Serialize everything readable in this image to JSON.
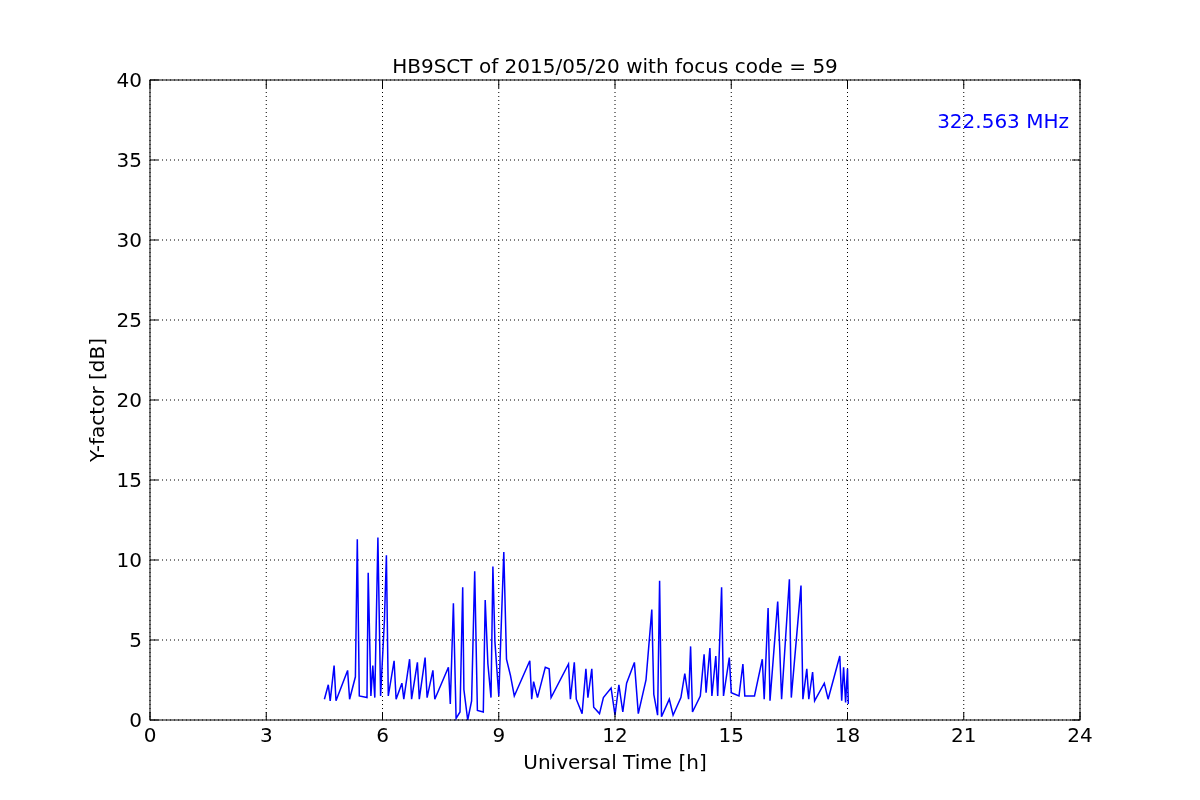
{
  "chart_data": {
    "type": "line",
    "title": "HB9SCT of 2015/05/20 with focus code = 59",
    "xlabel": "Universal Time [h]",
    "ylabel": "Y-factor [dB]",
    "x": [
      4.5,
      4.6,
      4.65,
      4.75,
      4.8,
      5.1,
      5.15,
      5.3,
      5.35,
      5.4,
      5.6,
      5.63,
      5.7,
      5.75,
      5.8,
      5.88,
      5.95,
      6.05,
      6.1,
      6.15,
      6.3,
      6.35,
      6.5,
      6.55,
      6.7,
      6.75,
      6.9,
      6.95,
      7.1,
      7.15,
      7.3,
      7.35,
      7.7,
      7.75,
      7.83,
      7.9,
      8.0,
      8.07,
      8.1,
      8.2,
      8.3,
      8.38,
      8.45,
      8.6,
      8.65,
      8.72,
      8.8,
      8.85,
      8.9,
      9.0,
      9.13,
      9.2,
      9.3,
      9.4,
      9.8,
      9.85,
      9.9,
      10.0,
      10.2,
      10.3,
      10.35,
      10.8,
      10.85,
      10.95,
      11.0,
      11.15,
      11.25,
      11.3,
      11.4,
      11.45,
      11.6,
      11.7,
      11.9,
      12.0,
      12.1,
      12.2,
      12.3,
      12.5,
      12.6,
      12.8,
      12.95,
      13.0,
      13.1,
      13.15,
      13.2,
      13.4,
      13.5,
      13.7,
      13.8,
      13.9,
      13.95,
      14.0,
      14.2,
      14.3,
      14.35,
      14.45,
      14.5,
      14.6,
      14.65,
      14.75,
      14.8,
      14.95,
      15.0,
      15.2,
      15.3,
      15.35,
      15.6,
      15.8,
      15.85,
      15.95,
      16.0,
      16.2,
      16.25,
      16.3,
      16.5,
      16.55,
      16.8,
      16.85,
      16.95,
      17.0,
      17.1,
      17.15,
      17.4,
      17.5,
      17.8,
      17.85,
      17.9,
      17.95,
      18.0,
      18.02
    ],
    "series": [
      {
        "name": "322.563 MHz",
        "color": "#0000ff",
        "values": [
          1.3,
          2.2,
          1.2,
          3.4,
          1.2,
          3.1,
          1.3,
          2.7,
          11.3,
          1.5,
          1.4,
          9.2,
          1.5,
          3.4,
          1.4,
          11.4,
          1.5,
          6.2,
          10.3,
          1.5,
          3.7,
          1.3,
          2.3,
          1.3,
          3.8,
          1.3,
          3.6,
          1.3,
          3.9,
          1.4,
          3.1,
          1.3,
          3.3,
          1.0,
          7.3,
          0.1,
          0.5,
          8.3,
          1.9,
          0.0,
          1.2,
          9.3,
          0.6,
          0.5,
          7.5,
          3.5,
          1.4,
          9.6,
          4.9,
          1.5,
          10.5,
          3.8,
          2.8,
          1.5,
          3.7,
          1.3,
          2.4,
          1.4,
          3.3,
          3.2,
          1.4,
          3.5,
          1.3,
          3.6,
          1.3,
          0.4,
          3.2,
          1.4,
          3.2,
          0.8,
          0.4,
          1.4,
          2.0,
          0.3,
          2.2,
          0.5,
          2.3,
          3.6,
          0.4,
          2.5,
          6.9,
          1.6,
          0.3,
          8.7,
          0.2,
          1.3,
          0.3,
          1.4,
          2.9,
          1.3,
          4.6,
          0.5,
          1.5,
          4.1,
          1.7,
          4.5,
          1.5,
          4.0,
          1.5,
          8.3,
          1.5,
          3.9,
          1.7,
          1.5,
          3.5,
          1.5,
          1.5,
          3.8,
          1.3,
          7.0,
          1.2,
          7.4,
          4.5,
          1.3,
          8.8,
          1.4,
          8.4,
          1.3,
          3.2,
          1.3,
          3.0,
          1.2,
          2.3,
          1.3,
          4.0,
          1.2,
          3.3,
          1.1,
          3.2,
          1.0
        ]
      }
    ],
    "xlim": [
      0,
      24
    ],
    "ylim": [
      0,
      40
    ],
    "xticks": [
      0,
      3,
      6,
      9,
      12,
      15,
      18,
      21,
      24
    ],
    "yticks": [
      0,
      5,
      10,
      15,
      20,
      25,
      30,
      35,
      40
    ],
    "grid": true
  }
}
